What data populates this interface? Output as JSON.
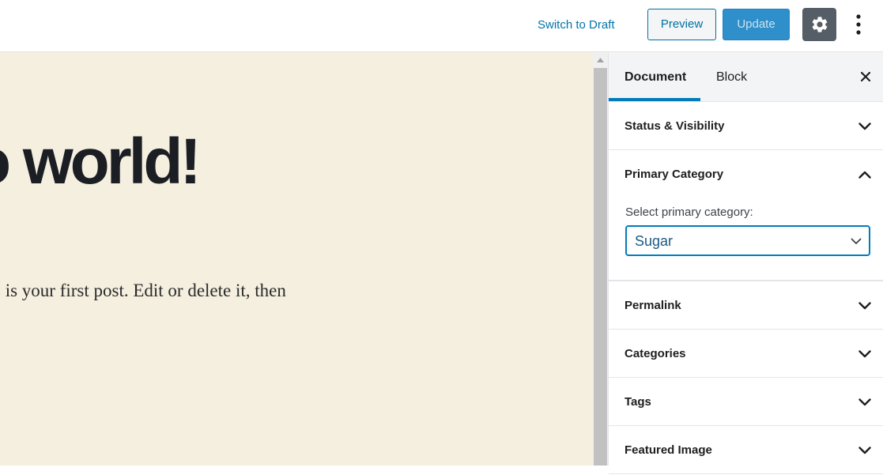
{
  "toolbar": {
    "switch_to_draft": "Switch to Draft",
    "preview": "Preview",
    "update": "Update",
    "settings_icon": "gear-icon",
    "more_icon": "vertical-ellipsis-icon",
    "accent": "#0073aa",
    "settings_bg": "#555d66"
  },
  "editor": {
    "title": "o world!",
    "body": "s is your first post. Edit or delete it, then",
    "background": "#f5efe0"
  },
  "sidebar": {
    "tabs": [
      {
        "label": "Document",
        "active": true
      },
      {
        "label": "Block",
        "active": false
      }
    ],
    "close_icon": "close-icon",
    "panels": [
      {
        "title": "Status & Visibility",
        "open": false
      },
      {
        "title": "Primary Category",
        "open": true,
        "field_label": "Select primary category:",
        "selected": "Sugar"
      },
      {
        "title": "Permalink",
        "open": false
      },
      {
        "title": "Categories",
        "open": false
      },
      {
        "title": "Tags",
        "open": false
      },
      {
        "title": "Featured Image",
        "open": false
      }
    ]
  }
}
